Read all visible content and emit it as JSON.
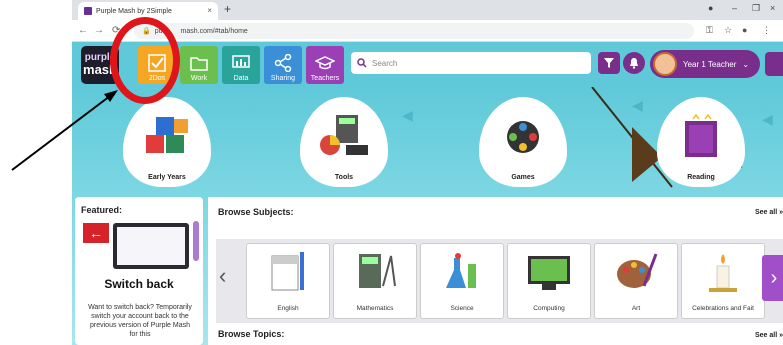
{
  "browser": {
    "tab_title": "Purple Mash by 2Simple",
    "tab_close": "×",
    "new_tab": "+",
    "url": "purplemash.com/#tab/home",
    "url_visible_start": "pu",
    "url_visible_end": "mash.com/#tab/home",
    "nav_back": "←",
    "nav_forward": "→",
    "win_minimize": "–",
    "win_restore": "❐",
    "win_close": "×"
  },
  "header": {
    "logo_line1": "purple",
    "logo_line2": "mash",
    "nav": [
      {
        "label": "2Dos",
        "color": "#f5a623"
      },
      {
        "label": "Work",
        "color": "#6bbf4e"
      },
      {
        "label": "Data",
        "color": "#2aa39a"
      },
      {
        "label": "Sharing",
        "color": "#3a8fd6"
      },
      {
        "label": "Teachers",
        "color": "#9b3fb5"
      }
    ],
    "search_placeholder": "Search",
    "user_label": "Year 1 Teacher"
  },
  "categories": [
    {
      "label": "Early Years"
    },
    {
      "label": "Tools"
    },
    {
      "label": "Games"
    },
    {
      "label": "Reading"
    }
  ],
  "featured": {
    "title": "Featured:",
    "heading": "Switch back",
    "text": "Want to switch back? Temporarily switch your account back to the previous version of Purple Mash for this"
  },
  "subjects": {
    "title": "Browse Subjects:",
    "see_all": "See all »",
    "items": [
      {
        "label": "English"
      },
      {
        "label": "Mathematics"
      },
      {
        "label": "Science"
      },
      {
        "label": "Computing"
      },
      {
        "label": "Art"
      },
      {
        "label": "Celebrations and Fait"
      }
    ],
    "topics_title": "Browse Topics:",
    "topics_see_all": "See all »"
  },
  "colors": {
    "brand_purple": "#7a2e8c",
    "header_teal": "#5fc9d9",
    "annotation_red": "#e0141b"
  }
}
